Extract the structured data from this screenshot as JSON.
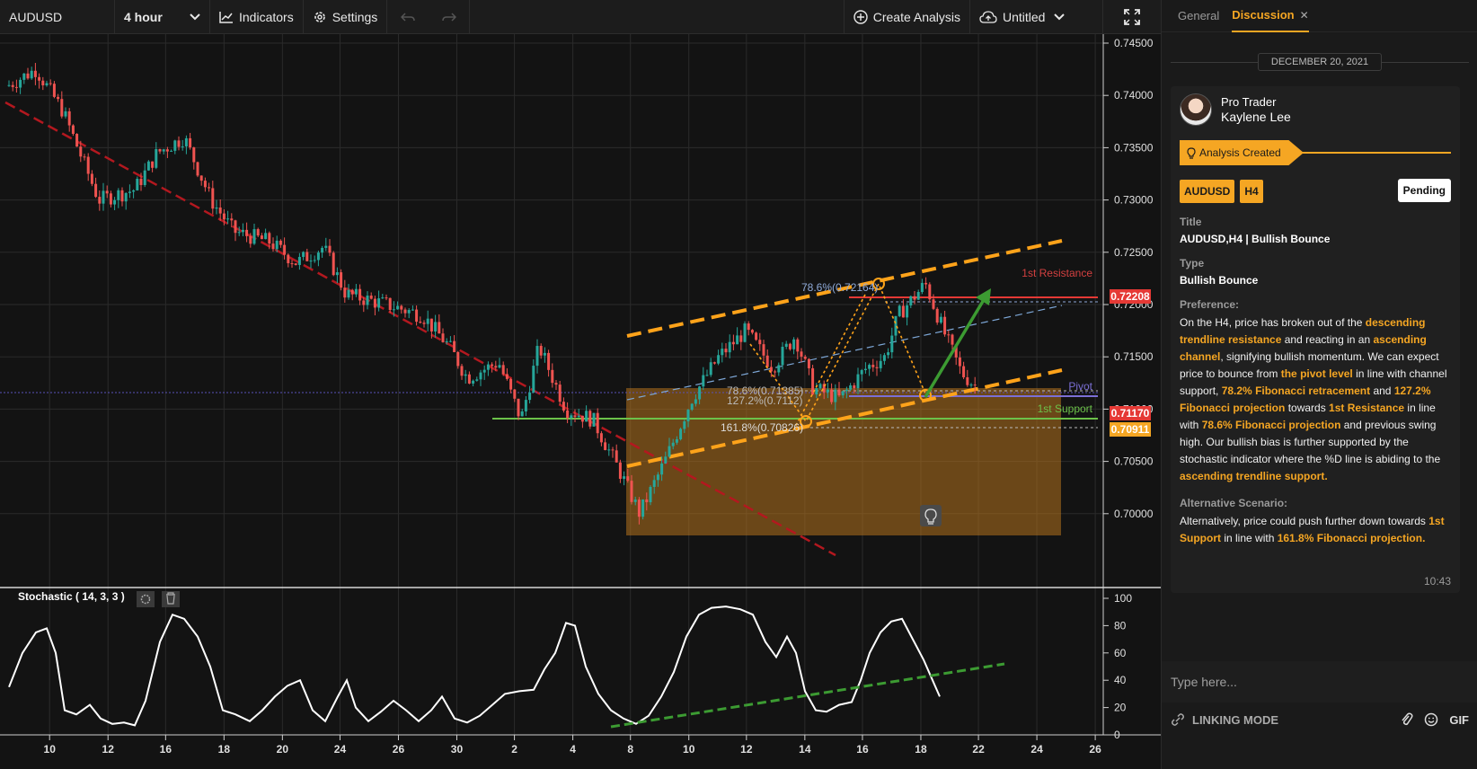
{
  "toolbar": {
    "symbol": "AUDUSD",
    "timeframe": "4 hour",
    "indicators_label": "Indicators",
    "settings_label": "Settings",
    "create_analysis_label": "Create Analysis",
    "layout_name": "Untitled"
  },
  "chart_data": {
    "type": "candlestick",
    "symbol": "AUDUSD",
    "timeframe": "4 hour",
    "y_ticks": [
      "0.74500",
      "0.74000",
      "0.73500",
      "0.73000",
      "0.72500",
      "0.72000",
      "0.71500",
      "0.71000",
      "0.70500",
      "0.70000"
    ],
    "ylim": [
      0.6975,
      0.745
    ],
    "x_ticks": [
      "10",
      "12",
      "16",
      "18",
      "20",
      "24",
      "26",
      "30",
      "2",
      "4",
      "8",
      "10",
      "12",
      "14",
      "16",
      "18",
      "22",
      "24",
      "26"
    ],
    "price_labels": [
      {
        "value": "0.72208",
        "color": "#e53935"
      },
      {
        "value": "0.71170",
        "color": "#e53935"
      },
      {
        "value": "0.70911",
        "color": "#f5a623"
      }
    ],
    "levels": [
      {
        "label": "1st Resistance",
        "value": 0.72208,
        "color": "#e53935"
      },
      {
        "label": "Pivot",
        "value": 0.7117,
        "color": "#7b6fd6"
      },
      {
        "label": "1st Support",
        "value": 0.70911,
        "color": "#6cc24a"
      }
    ],
    "fib_labels": [
      "78.6%(0.72164)",
      "78.6%(0.71385)",
      "127.2%(0.7112)",
      "161.8%(0.70826)"
    ],
    "indicator": {
      "label": "Stochastic ( 14, 3, 3 )",
      "y_ticks": [
        "100",
        "80",
        "60",
        "40",
        "20",
        "0"
      ],
      "ylim": [
        0,
        100
      ]
    }
  },
  "panel": {
    "tab_general": "General",
    "tab_discussion": "Discussion",
    "date": "DECEMBER 20, 2021",
    "author_role": "Pro Trader",
    "author_name": "Kaylene Lee",
    "created_label": "Analysis Created",
    "badge_symbol": "AUDUSD",
    "badge_timeframe": "H4",
    "status": "Pending",
    "title_label": "Title",
    "title_value": "AUDUSD,H4 | Bullish Bounce",
    "type_label": "Type",
    "type_value": "Bullish Bounce",
    "preference_label": "Preference:",
    "preference": {
      "t1": "On the H4, price has broken out of the ",
      "h1": "descending trendline resistance",
      "t2": " and reacting in an ",
      "h2": "ascending channel",
      "t3": ", signifying bullish momentum. We can expect price to bounce from ",
      "h3": "the pivot level",
      "t4": " in line with channel support, ",
      "h4": "78.2% Fibonacci retracement",
      "t5": " and ",
      "h5": "127.2% Fibonacci projection",
      "t6": " towards ",
      "h6": "1st Resistance",
      "t7": " in line with ",
      "h7": "78.6% Fibonacci projection",
      "t8": " and previous swing high. Our bullish bias is further supported by the stochastic indicator where the %D line is abiding to the ",
      "h8": "ascending trendline support."
    },
    "alt_label": "Alternative Scenario:",
    "alternative": {
      "t1": "Alternatively, price could push further down towards ",
      "h1": "1st Support",
      "t2": " in line with ",
      "h2": "161.8% Fibonacci projection."
    },
    "time": "10:43",
    "input_placeholder": "Type here...",
    "linking_mode": "LINKING MODE",
    "gif_label": "GIF"
  }
}
